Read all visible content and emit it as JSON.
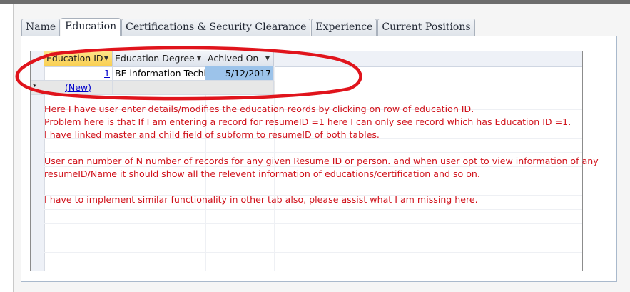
{
  "tabs": [
    {
      "label": "Name",
      "active": false
    },
    {
      "label": "Education",
      "active": true
    },
    {
      "label": "Certifications & Security Clearance",
      "active": false
    },
    {
      "label": "Experience",
      "active": false
    },
    {
      "label": "Current Positions",
      "active": false
    }
  ],
  "grid": {
    "columns": [
      "Education ID",
      "Education Degree",
      "Achived On"
    ],
    "row": {
      "id": "1",
      "degree": "BE information Techi",
      "achieved_on": "5/12/2017"
    },
    "new_row": {
      "marker": "*",
      "label": "(New)"
    }
  },
  "annotation": {
    "line1": "Here I have user enter details/modifies the education reords by clicking on row of education ID.",
    "line2": "Problem here is that If I am entering a record for resumeID =1 here I can only see record which has Education ID =1.",
    "line3": "I have linked master and child field of subform to resumeID of both tables.",
    "line4": "User can number of N number of records for any given Resume ID or person. and when user opt to view information of any",
    "line5": "resumeID/Name it should show all the relevent information of educations/certification and so on.",
    "line6": "I have to implement similar functionality in other tab also, please assist what I am missing here."
  },
  "colors": {
    "annotation": "#d0121b",
    "ellipse": "#e0141c",
    "selected_header": "#f9cf4f",
    "selected_cell": "#9cc3ea",
    "link": "#0000cc"
  }
}
